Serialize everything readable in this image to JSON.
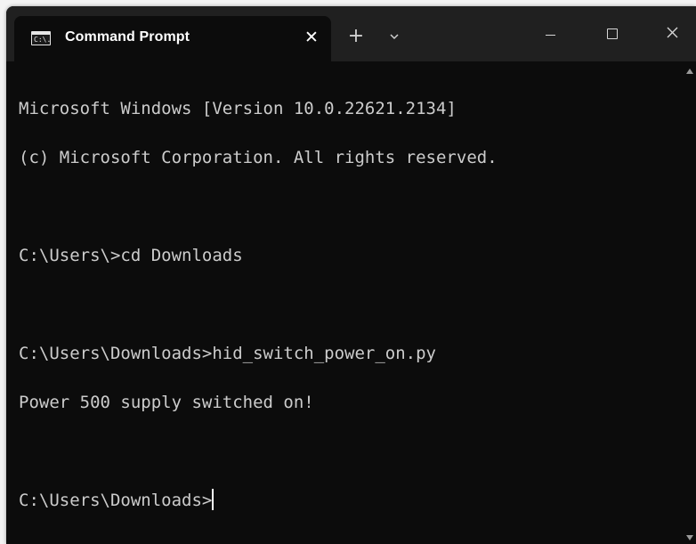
{
  "window": {
    "tab_title": "Command Prompt",
    "tab_icon_text": "C:\\.",
    "close_tab_label": "✕",
    "new_tab_label": "+"
  },
  "terminal": {
    "lines": [
      "Microsoft Windows [Version 10.0.22621.2134]",
      "(c) Microsoft Corporation. All rights reserved.",
      "",
      "C:\\Users\\>cd Downloads",
      "",
      "C:\\Users\\Downloads>hid_switch_power_on.py",
      "Power 500 supply switched on!",
      "",
      "C:\\Users\\Downloads>"
    ]
  },
  "colors": {
    "titlebar": "#202020",
    "terminal_bg": "#0c0c0c",
    "terminal_text": "#cccccc"
  },
  "icons": {
    "tab_icon": "command-prompt-icon",
    "close_tab": "close-icon",
    "new_tab": "plus-icon",
    "dropdown": "chevron-down-icon",
    "minimize": "minimize-icon",
    "maximize": "maximize-icon",
    "close_window": "close-icon"
  }
}
